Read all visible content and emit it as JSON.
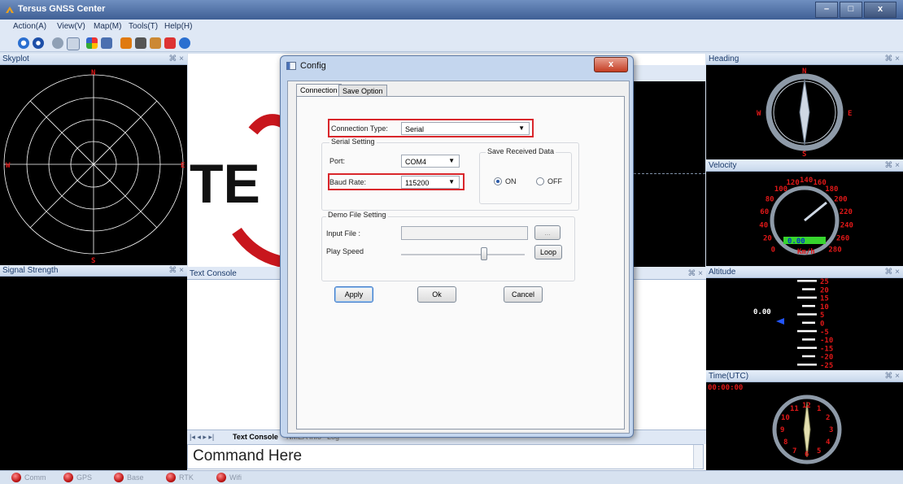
{
  "app": {
    "title": "Tersus GNSS Center"
  },
  "menu": [
    "Action(A)",
    "View(V)",
    "Map(M)",
    "Tools(T)",
    "Help(H)"
  ],
  "panels": {
    "skyplot": "Skyplot",
    "signal": "Signal Strength",
    "text_console": "Text Console",
    "heading": "Heading",
    "velocity": "Velocity",
    "altitude": "Altitude",
    "time": "Time(UTC)",
    "pin": "⌘ ×"
  },
  "skyplot": {
    "n": "N",
    "s": "S",
    "w": "W",
    "e": "E"
  },
  "heading": {
    "n": "N",
    "s": "S",
    "w": "W",
    "e": "E"
  },
  "velocity": {
    "ticks": [
      "0",
      "20",
      "40",
      "60",
      "80",
      "100",
      "120",
      "140",
      "160",
      "180",
      "200",
      "220",
      "240",
      "260",
      "280"
    ],
    "readout": "0.00",
    "unit": "Km/h"
  },
  "altitude": {
    "readout": "0.00",
    "ticks": [
      "25",
      "20",
      "15",
      "10",
      "5",
      "0",
      "-5",
      "-10",
      "-15",
      "-20",
      "-25"
    ]
  },
  "time": {
    "readout": "00:00:00",
    "numbers": [
      "12",
      "1",
      "2",
      "3",
      "4",
      "5",
      "6",
      "7",
      "8",
      "9",
      "10",
      "11"
    ]
  },
  "console": {
    "tabs": [
      "Text Console",
      "NMEA Info",
      "Log"
    ],
    "command": "Command Here",
    "logo_text": "TE"
  },
  "status": [
    "Comm",
    "GPS",
    "Base",
    "RTK",
    "Wifi"
  ],
  "dialog": {
    "title": "Config",
    "close": "x",
    "tabs": [
      "Connection",
      "Save Option"
    ],
    "connection_type_label": "Connection Type:",
    "connection_type_value": "Serial",
    "serial_setting": "Serial Setting",
    "port_label": "Port:",
    "port_value": "COM4",
    "baud_label": "Baud Rate:",
    "baud_value": "115200",
    "save_received": "Save Received Data",
    "on": "ON",
    "off": "OFF",
    "demo_file": "Demo File Setting",
    "input_file": "Input File :",
    "play_speed": "Play Speed",
    "browse": "...",
    "loop": "Loop",
    "apply": "Apply",
    "ok": "Ok",
    "cancel": "Cancel"
  },
  "colors": {
    "accent_red": "#d9262b",
    "gauge_red": "#e01818",
    "bg": "#d7e2f0"
  }
}
